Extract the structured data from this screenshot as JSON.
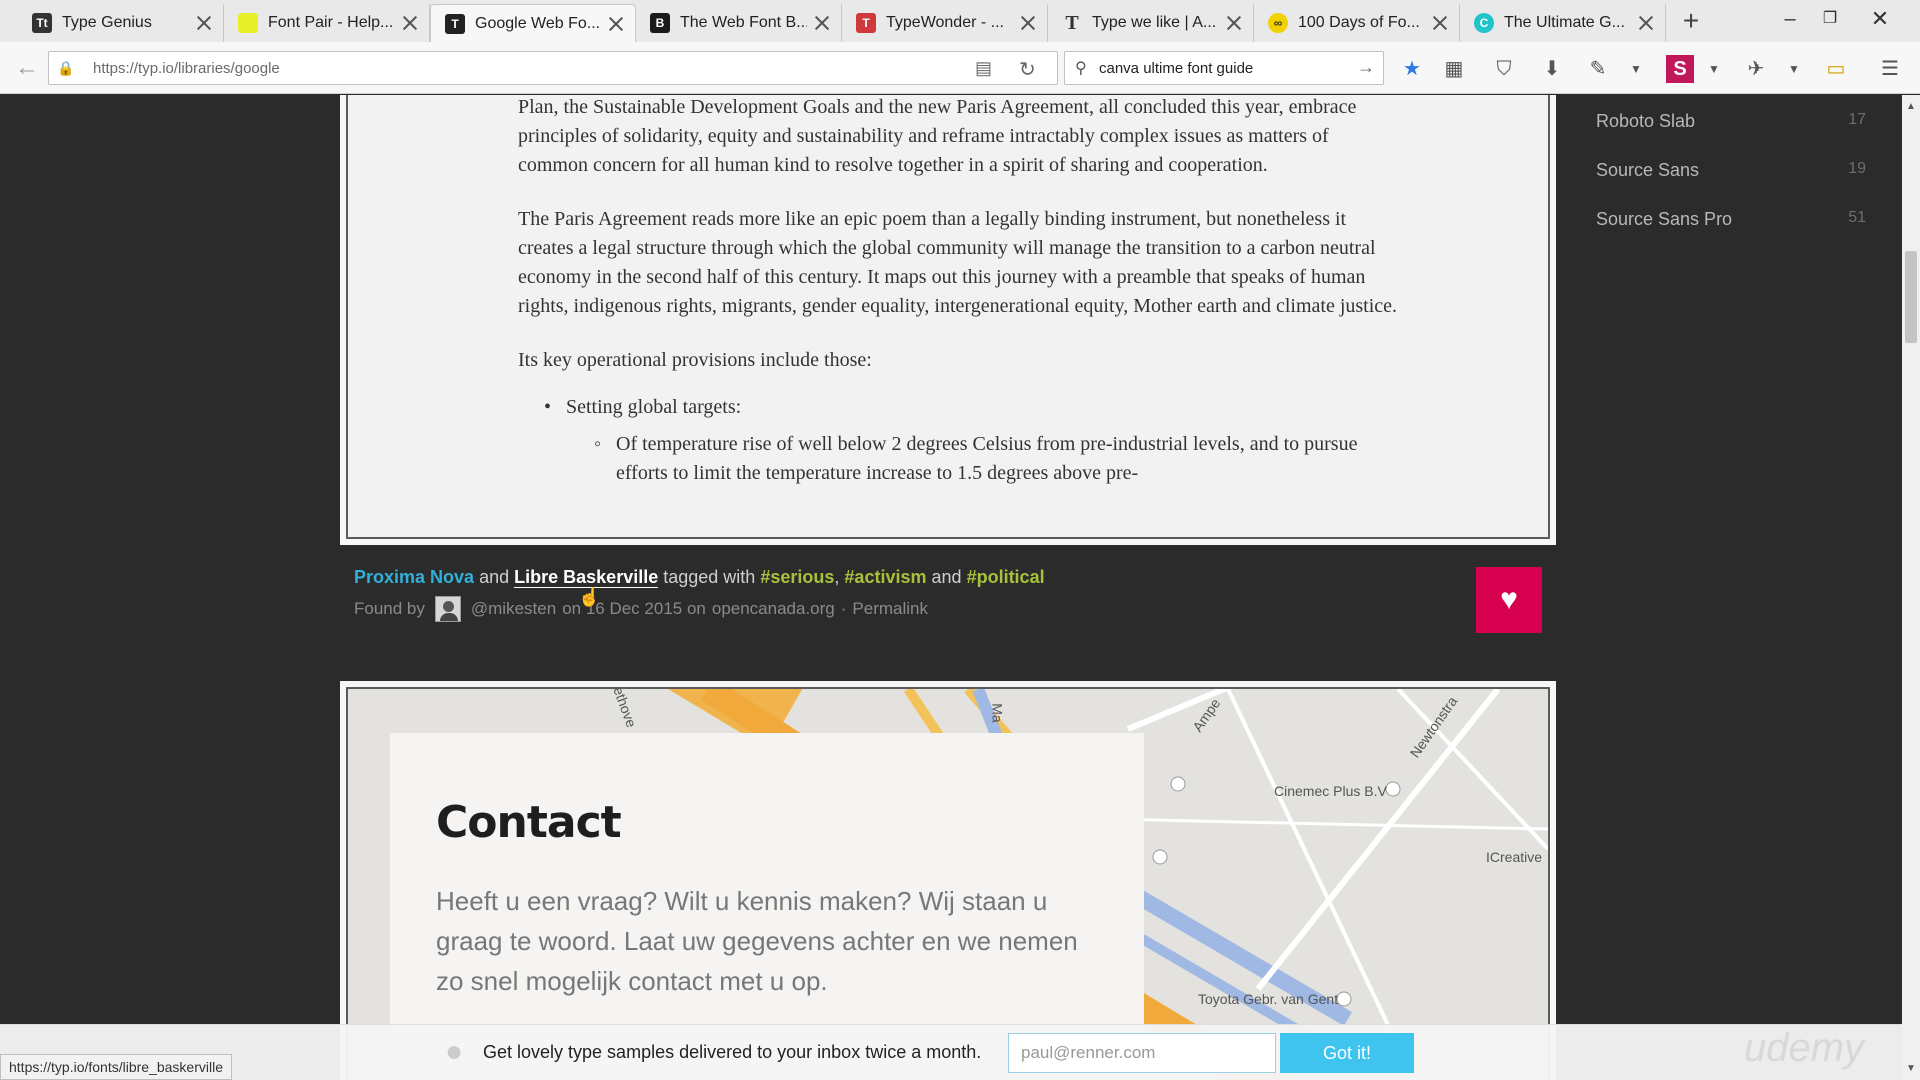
{
  "tabs": [
    {
      "title": "Type Genius",
      "favicon": "Tt",
      "color": "#333333"
    },
    {
      "title": "Font Pair - Help...",
      "favicon": "",
      "color": "#e8f02a"
    },
    {
      "title": "Google Web Fo...",
      "favicon": "T",
      "color": "#222222",
      "active": true
    },
    {
      "title": "The Web Font B...",
      "favicon": "B",
      "color": "#1a1a1a"
    },
    {
      "title": "TypeWonder - ...",
      "favicon": "T",
      "color": "#d0393b"
    },
    {
      "title": "Type we like | A...",
      "favicon": "T",
      "color": "#ffffff"
    },
    {
      "title": "100 Days of Fo...",
      "favicon": "∞",
      "color": "#f2d100"
    },
    {
      "title": "The Ultimate G...",
      "favicon": "C",
      "color": "#20c4cb"
    }
  ],
  "address_bar": {
    "url": "https://typ.io/libraries/google"
  },
  "search_bar": {
    "value": "canva ultime font guide"
  },
  "sidebar": {
    "items": [
      {
        "label": "Roboto Slab",
        "count": "17"
      },
      {
        "label": "Source Sans",
        "count": "19"
      },
      {
        "label": "Source Sans Pro",
        "count": "51"
      }
    ]
  },
  "sample1": {
    "para1": "Plan, the Sustainable Development Goals and the new Paris Agreement, all concluded this year, embrace principles of solidarity, equity and sustainability and reframe intractably complex issues as matters of common concern for all human kind to resolve together in a spirit of sharing and cooperation.",
    "para2": "The Paris Agreement reads more like an epic poem than a legally binding instrument, but nonetheless it creates a legal structure through which the global community will manage the transition to a carbon neutral economy in the second half of this century.  It maps out this journey with a preamble that speaks of human rights, indigenous rights, migrants, gender equality, intergenerational equity, Mother earth and climate justice.",
    "para3": "Its key operational provisions include those:",
    "bullet1": "Setting global targets:",
    "subbullet1": "Of temperature rise of well below 2 degrees Celsius from pre-industrial levels, and to pursue efforts to limit the temperature increase to 1.5 degrees above pre-"
  },
  "caption": {
    "font1": "Proxima Nova",
    "and1": "and",
    "font2": "Libre Baskerville",
    "tagged_with": "tagged with",
    "tag1": "#serious",
    "comma": ",",
    "tag2": "#activism",
    "and2": "and",
    "tag3": "#political",
    "found_by": "Found by",
    "user": "@mikesten",
    "date_text": "on 16 Dec 2015 on",
    "site": "opencanada.org",
    "separator": "·",
    "permalink": "Permalink"
  },
  "sample2": {
    "title": "Contact",
    "body": "Heeft u een vraag? Wilt u kennis maken? Wij staan u graag te woord. Laat uw gegevens achter en we nemen zo snel mogelijk contact met u op.",
    "map_labels": [
      "Cinemec Plus B.V",
      "ICreative",
      "Toyota Gebr. van Gent",
      "Newtonstra",
      "Ampe",
      "ethove",
      "Ma"
    ]
  },
  "newsletter": {
    "text": "Get lovely type samples delivered to your inbox twice a month.",
    "placeholder": "paul@renner.com",
    "button": "Got it!"
  },
  "status_bar": {
    "url": "https://typ.io/fonts/libre_baskerville"
  },
  "watermark": "udemy",
  "colors": {
    "accent_heart": "#d6004f",
    "font_link": "#32b0d8",
    "tag": "#a7c23a",
    "newsletter_button": "#3ec4ee"
  }
}
